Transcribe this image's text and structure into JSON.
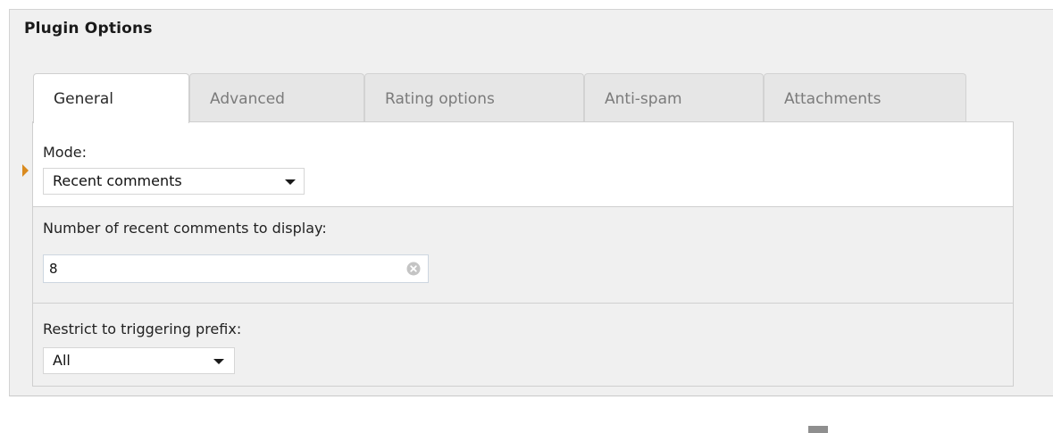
{
  "panel": {
    "title": "Plugin Options"
  },
  "tabs": [
    {
      "label": "General",
      "active": true
    },
    {
      "label": "Advanced",
      "active": false
    },
    {
      "label": "Rating options",
      "active": false
    },
    {
      "label": "Anti-spam",
      "active": false
    },
    {
      "label": "Attachments",
      "active": false
    }
  ],
  "fields": {
    "mode": {
      "label": "Mode:",
      "value": "Recent comments"
    },
    "count": {
      "label": "Number of recent comments to display:",
      "value": "8"
    },
    "prefix": {
      "label": "Restrict to triggering prefix:",
      "value": "All"
    }
  },
  "icons": {
    "select_caret": "chevron-down-icon",
    "clear": "clear-circle-icon",
    "row_marker": "triangle-right-icon"
  },
  "colors": {
    "accent_marker": "#d98a1e",
    "panel_bg": "#f0f0f0",
    "active_tab_bg": "#ffffff",
    "inactive_tab_bg": "#e6e6e6"
  }
}
